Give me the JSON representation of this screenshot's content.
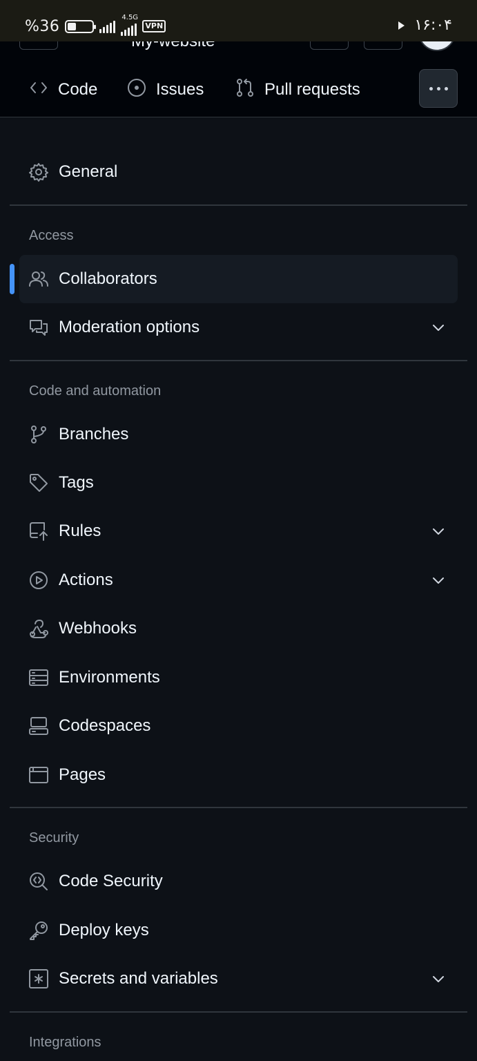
{
  "status_bar": {
    "battery_text": "%36",
    "battery_level": 0.36,
    "network_label": "4.5G",
    "vpn_label": "VPN",
    "time": "۱۶:۰۴"
  },
  "repo": {
    "name": "My-website"
  },
  "tabs": [
    {
      "label": "Code",
      "icon": "code-icon"
    },
    {
      "label": "Issues",
      "icon": "issue-opened-icon"
    },
    {
      "label": "Pull requests",
      "icon": "git-pull-request-icon"
    }
  ],
  "menu": {
    "general": {
      "label": "General",
      "icon": "gear-icon"
    },
    "sections": [
      {
        "title": "Access",
        "items": [
          {
            "label": "Collaborators",
            "icon": "people-icon",
            "active": true
          },
          {
            "label": "Moderation options",
            "icon": "comment-discussion-icon",
            "expandable": true
          }
        ]
      },
      {
        "title": "Code and automation",
        "items": [
          {
            "label": "Branches",
            "icon": "git-branch-icon"
          },
          {
            "label": "Tags",
            "icon": "tag-icon"
          },
          {
            "label": "Rules",
            "icon": "repo-push-icon",
            "expandable": true
          },
          {
            "label": "Actions",
            "icon": "play-icon",
            "expandable": true
          },
          {
            "label": "Webhooks",
            "icon": "webhook-icon"
          },
          {
            "label": "Environments",
            "icon": "server-icon"
          },
          {
            "label": "Codespaces",
            "icon": "codespaces-icon"
          },
          {
            "label": "Pages",
            "icon": "browser-icon"
          }
        ]
      },
      {
        "title": "Security",
        "items": [
          {
            "label": "Code Security",
            "icon": "codescan-icon"
          },
          {
            "label": "Deploy keys",
            "icon": "key-icon"
          },
          {
            "label": "Secrets and variables",
            "icon": "key-asterisk-icon",
            "expandable": true
          }
        ]
      },
      {
        "title": "Integrations",
        "items": []
      }
    ]
  },
  "colors": {
    "background": "#0d1117",
    "header_background": "#010409",
    "accent": "#4493f8",
    "muted_text": "#9198a1",
    "border": "#30363d"
  }
}
